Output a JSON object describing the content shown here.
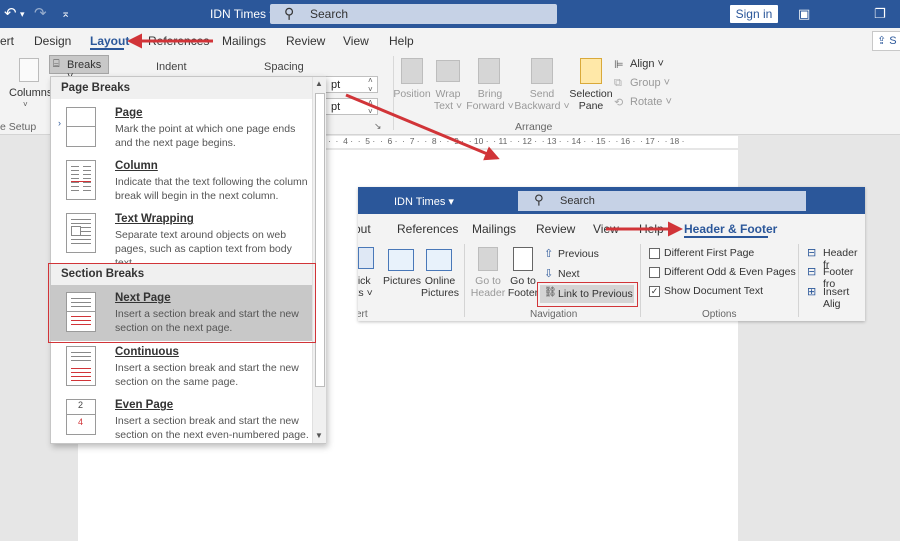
{
  "titlebar": {
    "doc_title": "IDN Times ▾",
    "search_placeholder": "Search",
    "signin_label": "Sign in",
    "undo_glyph": "↶",
    "redo_glyph": "↷",
    "customize_glyph": "⌅"
  },
  "tabs": {
    "insert": "ert",
    "design": "Design",
    "layout": "Layout",
    "references": "References",
    "mailings": "Mailings",
    "review": "Review",
    "view": "View",
    "help": "Help",
    "share": "S"
  },
  "ribbon": {
    "breaks_label": "Breaks ˅",
    "columns_label": "Columns",
    "page_setup_label": "e Setup",
    "indent_label": "Indent",
    "spacing_label": "Spacing",
    "spacing_before": "pt",
    "spacing_after": "pt",
    "arrange": {
      "position": "Position",
      "wrap_text": "Wrap\nText ˅",
      "bring_forward": "Bring\nForward ˅",
      "send_backward": "Send\nBackward ˅",
      "selection_pane": "Selection\nPane",
      "align": "Align ˅",
      "group": "Group ˅",
      "rotate": "Rotate ˅",
      "group_label": "Arrange"
    }
  },
  "ruler": {
    "ticks": "·  ·  4 ·  ·  5 ·  ·  6 ·  ·  7 ·  ·  8 ·  ·  9 ·  · 10 ·  · 11 ·  · 12 ·  · 13 ·  · 14 ·  · 15 ·  · 16 ·  · 17 ·  · 18 ·"
  },
  "dropdown": {
    "page_breaks_header": "Page Breaks",
    "section_breaks_header": "Section Breaks",
    "items": [
      {
        "title": "Page",
        "desc": "Mark the point at which one page ends and the next page begins."
      },
      {
        "title": "Column",
        "desc": "Indicate that the text following the column break will begin in the next column."
      },
      {
        "title": "Text Wrapping",
        "desc": "Separate text around objects on web pages, such as caption text from body text."
      },
      {
        "title": "Next Page",
        "desc": "Insert a section break and start the new section on the next page."
      },
      {
        "title": "Continuous",
        "desc": "Insert a section break and start the new section on the same page."
      },
      {
        "title": "Even Page",
        "desc": "Insert a section break and start the new section on the next even-numbered page."
      }
    ],
    "even_page_icon_text_1": "2",
    "even_page_icon_text_2": "4"
  },
  "inset": {
    "doc_title": "IDN Times ▾",
    "search_placeholder": "Search",
    "tabs": {
      "layout": "out",
      "references": "References",
      "mailings": "Mailings",
      "review": "Review",
      "view": "View",
      "help": "Help",
      "header_footer": "Header & Footer"
    },
    "insert": {
      "quick_parts": "uick\nrts ˅",
      "pictures": "Pictures",
      "online_pictures": "Online\nPictures",
      "group_label": "ert"
    },
    "navigation": {
      "go_to_header": "Go to\nHeader",
      "go_to_footer": "Go to\nFooter",
      "previous": "Previous",
      "next": "Next",
      "link_to_previous": "Link to Previous",
      "group_label": "Navigation"
    },
    "options": {
      "different_first_page": "Different First Page",
      "different_odd_even": "Different Odd & Even Pages",
      "show_document_text": "Show Document Text",
      "show_document_text_checked": "✓",
      "group_label": "Options"
    },
    "position": {
      "header_from": "Header fr",
      "footer_from": "Footer fro",
      "insert_align": "Insert Alig"
    }
  },
  "colors": {
    "title_bar": "#2b579a",
    "annotation_red": "#d13438",
    "ribbon_bg": "#f3f3f3"
  }
}
